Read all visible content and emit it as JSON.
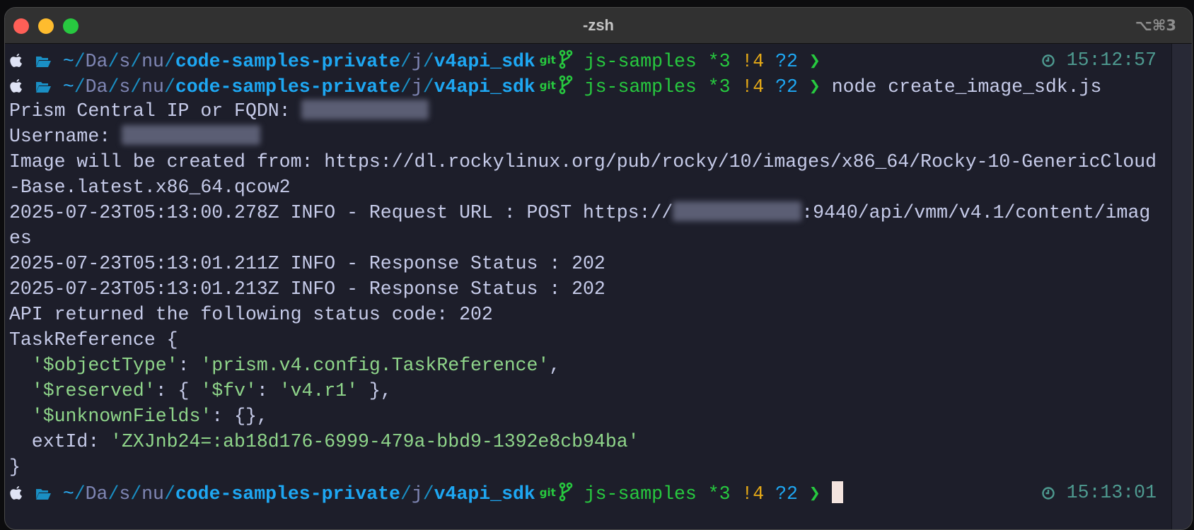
{
  "window": {
    "title": "-zsh",
    "shortcut": "⌥⌘3"
  },
  "prompt_parts": {
    "tilde": "~",
    "sep": "/",
    "d1": "Da",
    "d2": "s",
    "d3": "nu",
    "repo": "code-samples-private",
    "d4": "j",
    "dir": "v4api_sdk",
    "git": "git",
    "branch": "js-samples",
    "staged": "*3",
    "modified": "!4",
    "untracked": "?2",
    "arrow": "❯"
  },
  "prompts": [
    {
      "command": "",
      "time": "15:12:57"
    },
    {
      "command": "node create_image_sdk.js",
      "time": ""
    },
    {
      "command": "",
      "time": "15:13:01",
      "cursor": true
    }
  ],
  "output": [
    [
      {
        "t": "Prism Central IP or FQDN: "
      },
      {
        "redacted": "ip"
      }
    ],
    [
      {
        "t": "Username: "
      },
      {
        "redacted": "user"
      }
    ],
    [
      {
        "t": "Image will be created from: https://dl.rockylinux.org/pub/rocky/10/images/x86_64/Rocky-10-GenericCloud"
      }
    ],
    [
      {
        "t": "-Base.latest.x86_64.qcow2"
      }
    ],
    [
      {
        "t": "2025-07-23T05:13:00.278Z INFO - Request URL : POST https://"
      },
      {
        "redacted": "ip2"
      },
      {
        "t": ":9440/api/vmm/v4.1/content/imag"
      }
    ],
    [
      {
        "t": "es"
      }
    ],
    [
      {
        "t": "2025-07-23T05:13:01.211Z INFO - Response Status : 202"
      }
    ],
    [
      {
        "t": "2025-07-23T05:13:01.213Z INFO - Response Status : 202"
      }
    ],
    [
      {
        "t": "API returned the following status code: 202"
      }
    ],
    [
      {
        "t": "TaskReference {"
      }
    ],
    [
      {
        "t": "  "
      },
      {
        "t": "'$objectType'",
        "c": "str"
      },
      {
        "t": ": "
      },
      {
        "t": "'prism.v4.config.TaskReference'",
        "c": "str"
      },
      {
        "t": ","
      }
    ],
    [
      {
        "t": "  "
      },
      {
        "t": "'$reserved'",
        "c": "str"
      },
      {
        "t": ": { "
      },
      {
        "t": "'$fv'",
        "c": "str"
      },
      {
        "t": ": "
      },
      {
        "t": "'v4.r1'",
        "c": "str"
      },
      {
        "t": " },"
      }
    ],
    [
      {
        "t": "  "
      },
      {
        "t": "'$unknownFields'",
        "c": "str"
      },
      {
        "t": ": {},"
      }
    ],
    [
      {
        "t": "  extId: "
      },
      {
        "t": "'ZXJnb24=:ab18d176-6999-479a-bbd9-1392e8cb94ba'",
        "c": "str"
      }
    ],
    [
      {
        "t": "}"
      }
    ]
  ],
  "colors": {
    "background": "#1d1e2a",
    "text": "#c6cbe9",
    "path": "#1ea7f2",
    "git": "#27c93f",
    "modified": "#e5a917",
    "string": "#8fd58a",
    "clock": "#4e9a90",
    "cursor": "#f4e4df"
  }
}
